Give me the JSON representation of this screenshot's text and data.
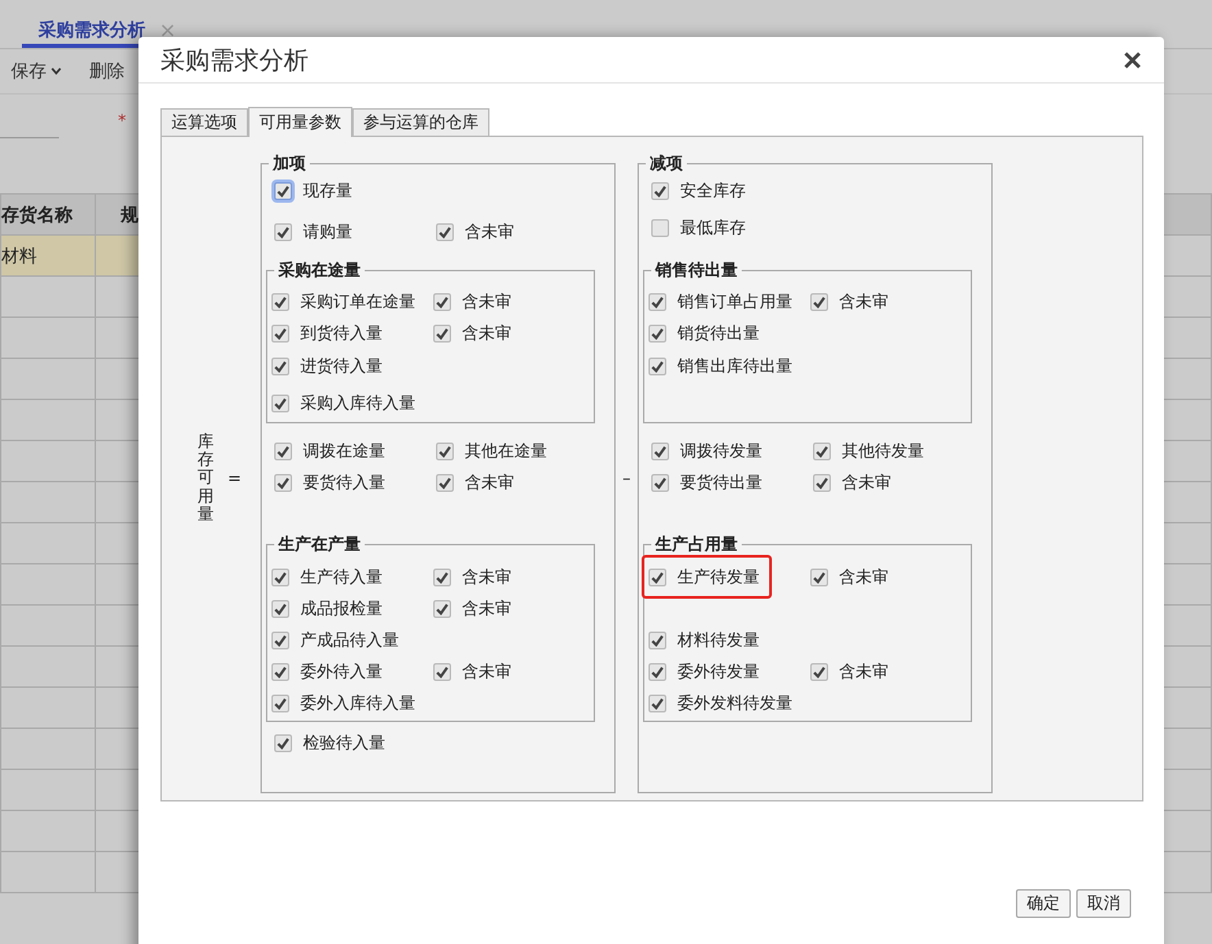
{
  "background": {
    "tab": {
      "label": "采购需求分析",
      "close": "×",
      "selected": true
    },
    "toolbar": [
      {
        "label": "保存",
        "dropdown": true
      },
      {
        "label": "删除",
        "dropdown": false
      }
    ],
    "required_mark": "*",
    "table": {
      "columns": [
        "存货名称",
        "规"
      ],
      "rows": [
        {
          "cells": [
            "材料"
          ],
          "selected": true
        }
      ]
    }
  },
  "dialog": {
    "title": "采购需求分析",
    "tabs": [
      {
        "label": "运算选项",
        "selected": false
      },
      {
        "label": "可用量参数",
        "selected": true
      },
      {
        "label": "参与运算的仓库",
        "selected": false
      }
    ],
    "formula_label": "库存可用量",
    "equals": "=",
    "minus": "–",
    "plus_group": {
      "title": "加项",
      "sections": [
        {
          "kind": "row",
          "items": [
            {
              "label": "现存量",
              "checked": true,
              "focused": true
            }
          ]
        },
        {
          "kind": "row",
          "items": [
            {
              "label": "请购量",
              "checked": true
            },
            {
              "label": "含未审",
              "checked": true
            }
          ]
        },
        {
          "kind": "fieldset",
          "title": "采购在途量",
          "rows": [
            {
              "items": [
                {
                  "label": "采购订单在途量",
                  "checked": true
                },
                {
                  "label": "含未审",
                  "checked": true
                }
              ]
            },
            {
              "items": [
                {
                  "label": "到货待入量",
                  "checked": true
                },
                {
                  "label": "含未审",
                  "checked": true
                }
              ]
            },
            {
              "items": [
                {
                  "label": "进货待入量",
                  "checked": true
                }
              ]
            },
            {
              "items": [
                {
                  "label": "采购入库待入量",
                  "checked": true
                }
              ]
            }
          ]
        },
        {
          "kind": "row",
          "items": [
            {
              "label": "调拨在途量",
              "checked": true
            },
            {
              "label": "其他在途量",
              "checked": true
            }
          ]
        },
        {
          "kind": "row",
          "items": [
            {
              "label": "要货待入量",
              "checked": true
            },
            {
              "label": "含未审",
              "checked": true
            }
          ]
        },
        {
          "kind": "fieldset",
          "title": "生产在产量",
          "rows": [
            {
              "items": [
                {
                  "label": "生产待入量",
                  "checked": true
                },
                {
                  "label": "含未审",
                  "checked": true
                }
              ]
            },
            {
              "items": [
                {
                  "label": "成品报检量",
                  "checked": true
                },
                {
                  "label": "含未审",
                  "checked": true
                }
              ]
            },
            {
              "items": [
                {
                  "label": "产成品待入量",
                  "checked": true
                }
              ]
            },
            {
              "items": [
                {
                  "label": "委外待入量",
                  "checked": true
                },
                {
                  "label": "含未审",
                  "checked": true
                }
              ]
            },
            {
              "items": [
                {
                  "label": "委外入库待入量",
                  "checked": true
                }
              ]
            }
          ]
        },
        {
          "kind": "row",
          "items": [
            {
              "label": "检验待入量",
              "checked": true
            }
          ]
        }
      ]
    },
    "minus_group": {
      "title": "减项",
      "sections": [
        {
          "kind": "row",
          "items": [
            {
              "label": "安全库存",
              "checked": true
            }
          ]
        },
        {
          "kind": "row",
          "items": [
            {
              "label": "最低库存",
              "checked": false
            }
          ]
        },
        {
          "kind": "fieldset",
          "title": "销售待出量",
          "rows": [
            {
              "items": [
                {
                  "label": "销售订单占用量",
                  "checked": true
                },
                {
                  "label": "含未审",
                  "checked": true
                }
              ]
            },
            {
              "items": [
                {
                  "label": "销货待出量",
                  "checked": true
                }
              ]
            },
            {
              "items": [
                {
                  "label": "销售出库待出量",
                  "checked": true
                }
              ]
            }
          ]
        },
        {
          "kind": "row",
          "items": [
            {
              "label": "调拨待发量",
              "checked": true
            },
            {
              "label": "其他待发量",
              "checked": true
            }
          ]
        },
        {
          "kind": "row",
          "items": [
            {
              "label": "要货待出量",
              "checked": true
            },
            {
              "label": "含未审",
              "checked": true
            }
          ]
        },
        {
          "kind": "fieldset",
          "title": "生产占用量",
          "rows": [
            {
              "items": [
                {
                  "label": "生产待发量",
                  "checked": true,
                  "highlighted": true
                },
                {
                  "label": "含未审",
                  "checked": true
                }
              ]
            },
            {
              "items": [
                {
                  "label": "材料待发量",
                  "checked": true
                }
              ]
            },
            {
              "items": [
                {
                  "label": "委外待发量",
                  "checked": true
                },
                {
                  "label": "含未审",
                  "checked": true
                }
              ]
            },
            {
              "items": [
                {
                  "label": "委外发料待发量",
                  "checked": true
                }
              ]
            }
          ]
        }
      ]
    },
    "buttons": [
      {
        "label": "确定"
      },
      {
        "label": "取消"
      }
    ]
  }
}
